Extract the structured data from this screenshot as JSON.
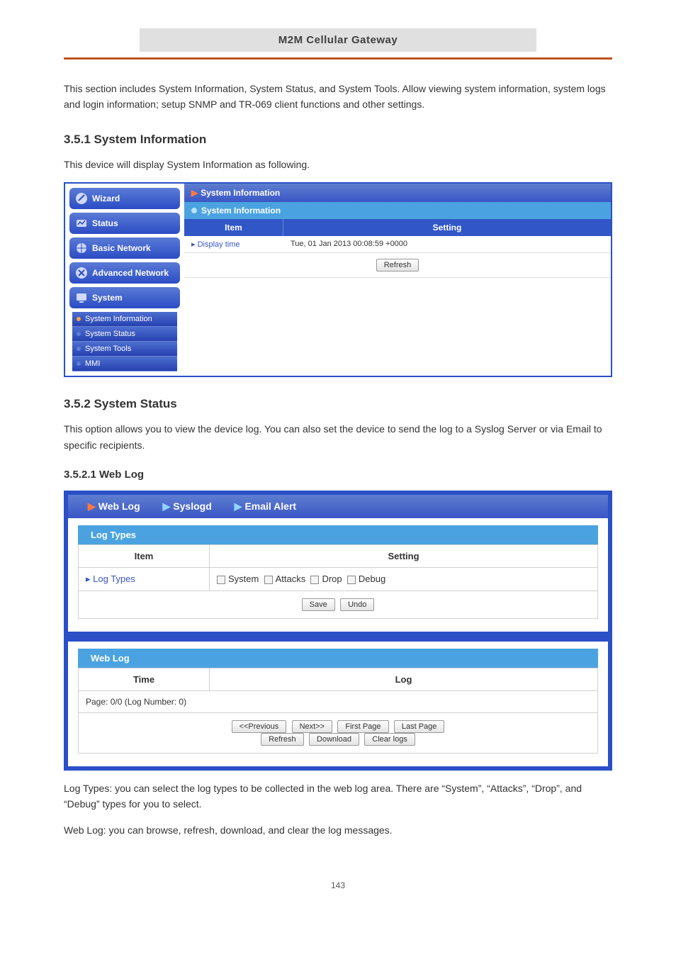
{
  "header": {
    "manual_title": "M2M Cellular Gateway"
  },
  "intro": "This section includes System Information, System Status, and System Tools. Allow viewing system information, system logs and login information; setup SNMP and TR-069 client functions and other settings.",
  "section_title": "3.5.1 System Information",
  "section_body": "This device will display System Information as following.",
  "admin": {
    "nav": {
      "wizard": "Wizard",
      "status": "Status",
      "basic": "Basic Network",
      "advanced": "Advanced Network",
      "system": "System",
      "system_children": [
        "System Information",
        "System Status",
        "System Tools",
        "MMI"
      ]
    },
    "crumb": "System Information",
    "panel_title": "System Information",
    "columns": {
      "item": "Item",
      "setting": "Setting"
    },
    "row": {
      "item": "Display time",
      "setting": "Tue, 01 Jan 2013 00:08:59 +0000"
    },
    "refresh_btn": "Refresh"
  },
  "subsection_title": "3.5.2 System Status",
  "subsection_body1": "This option allows you to view the device log. You can also set the device to send the log to a Syslog Server or via Email to specific recipients.",
  "sub_heading": "3.5.2.1 Web Log",
  "log": {
    "tabs": [
      "Web Log",
      "Syslogd",
      "Email Alert"
    ],
    "panel1_title": "Log Types",
    "header": {
      "c1": "Item",
      "c2": "Setting"
    },
    "log_types_label": "Log Types",
    "options": [
      "System",
      "Attacks",
      "Drop",
      "Debug"
    ],
    "save_btn": "Save",
    "undo_btn": "Undo",
    "panel2_title": "Web Log",
    "header2": {
      "c1": "Time",
      "c2": "Log"
    },
    "page_row": "Page: 0/0 (Log Number: 0)",
    "buttons": [
      "<<Previous",
      "Next>>",
      "First Page",
      "Last Page",
      "Refresh",
      "Download",
      "Clear logs"
    ]
  },
  "log_types_note_prefix": "Log Types: you can select the log types to be collected in the web log area. There are ",
  "log_types_note_items": [
    "System",
    "Attacks",
    "Drop",
    "Debug"
  ],
  "log_types_note_suffix": " types for you to select.",
  "web_log_note": "Web Log: you can browse, refresh, download, and clear the log messages.",
  "page_number": "143"
}
